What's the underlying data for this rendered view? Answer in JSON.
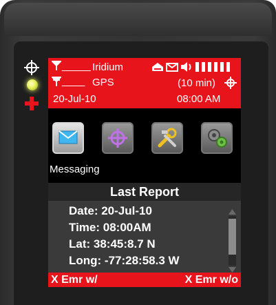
{
  "status": {
    "iridium_signal": "_____",
    "iridium_label": "Iridium",
    "gps_signal": "____",
    "gps_label": "GPS",
    "interval": "(10 min)",
    "date": "20-Jul-10",
    "time": "08:00 AM",
    "battery_level": 1.0
  },
  "apps": {
    "items": [
      "messaging",
      "gps",
      "tools",
      "settings"
    ],
    "selected_label": "Messaging"
  },
  "report": {
    "title": "Last Report",
    "date": "Date: 20-Jul-10",
    "time": "Time: 08:00AM",
    "lat": "Lat: 38:45:8.7 N",
    "long": "Long: -77:28:58.3 W"
  },
  "softkeys": {
    "left": "X Emr w/",
    "right": "X Emr w/o"
  },
  "colors": {
    "accent_red": "#e8141c",
    "screen_black": "#000000",
    "report_bg": "#3a3a3a"
  }
}
